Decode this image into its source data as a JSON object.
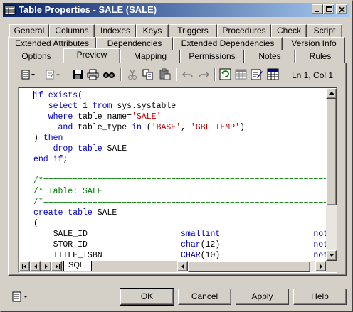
{
  "window": {
    "title": "Table Properties - SALE (SALE)"
  },
  "tabs": {
    "row1": [
      "General",
      "Columns",
      "Indexes",
      "Keys",
      "Triggers",
      "Procedures",
      "Check",
      "Script"
    ],
    "row2": [
      "Extended Attributes",
      "Dependencies",
      "Extended Dependencies",
      "Version Info"
    ],
    "row3": [
      "Options",
      "Preview",
      "Mapping",
      "Permissions",
      "Notes",
      "Rules"
    ],
    "active": "Preview"
  },
  "toolbar": {
    "icons": [
      "properties-menu-icon",
      "edit-menu-icon",
      "save-icon",
      "print-icon",
      "find-icon",
      "cut-icon",
      "copy-icon",
      "paste-icon",
      "undo-icon",
      "redo-icon",
      "refresh-icon",
      "table-icon",
      "edit-doc-icon",
      "grid-icon"
    ],
    "position": "Ln 1, Col 1"
  },
  "code": {
    "lines": [
      [
        [
          "kw",
          "if exists("
        ]
      ],
      [
        [
          "pl",
          "   "
        ],
        [
          "kw",
          "select"
        ],
        [
          "pl",
          " 1 "
        ],
        [
          "kw",
          "from"
        ],
        [
          "pl",
          " sys.systable"
        ]
      ],
      [
        [
          "pl",
          "   "
        ],
        [
          "kw",
          "where"
        ],
        [
          "pl",
          " table_name="
        ],
        [
          "str",
          "'SALE'"
        ]
      ],
      [
        [
          "pl",
          "     "
        ],
        [
          "kw",
          "and"
        ],
        [
          "pl",
          " table_type "
        ],
        [
          "kw",
          "in"
        ],
        [
          "pl",
          " ("
        ],
        [
          "str",
          "'BASE'"
        ],
        [
          "pl",
          ", "
        ],
        [
          "str",
          "'GBL TEMP'"
        ],
        [
          "pl",
          ")"
        ]
      ],
      [
        [
          "pl",
          ") "
        ],
        [
          "kw",
          "then"
        ]
      ],
      [
        [
          "pl",
          "    "
        ],
        [
          "kw",
          "drop table"
        ],
        [
          "pl",
          " SALE"
        ]
      ],
      [
        [
          "kw",
          "end if"
        ],
        [
          "pl",
          ";"
        ]
      ],
      [
        [
          "pl",
          ""
        ]
      ],
      [
        [
          "cm",
          "/*=============================================================="
        ]
      ],
      [
        [
          "cm",
          "/* Table: SALE"
        ]
      ],
      [
        [
          "cm",
          "/*=============================================================="
        ]
      ],
      [
        [
          "kw",
          "create table"
        ],
        [
          "pl",
          " SALE"
        ]
      ],
      [
        [
          "pl",
          "("
        ]
      ],
      [
        [
          "pl",
          "    SALE_ID                   "
        ],
        [
          "kw",
          "smallint"
        ],
        [
          "pl",
          "                   "
        ],
        [
          "kw",
          "not"
        ]
      ],
      [
        [
          "pl",
          "    STOR_ID                   "
        ],
        [
          "kw",
          "char"
        ],
        [
          "pl",
          "(12)                   "
        ],
        [
          "kw",
          "not"
        ]
      ],
      [
        [
          "pl",
          "    TITLE_ISBN                "
        ],
        [
          "kw",
          "CHAR"
        ],
        [
          "pl",
          "(10)                   "
        ],
        [
          "kw",
          "not"
        ]
      ]
    ]
  },
  "editor_tabs": [
    "SQL"
  ],
  "buttons": {
    "ok": "OK",
    "cancel": "Cancel",
    "apply": "Apply",
    "help": "Help"
  },
  "colors": {
    "keyword": "#0000c0",
    "string": "#c00000",
    "comment": "#008000",
    "title_start": "#0a246a",
    "title_end": "#a6caf0"
  }
}
